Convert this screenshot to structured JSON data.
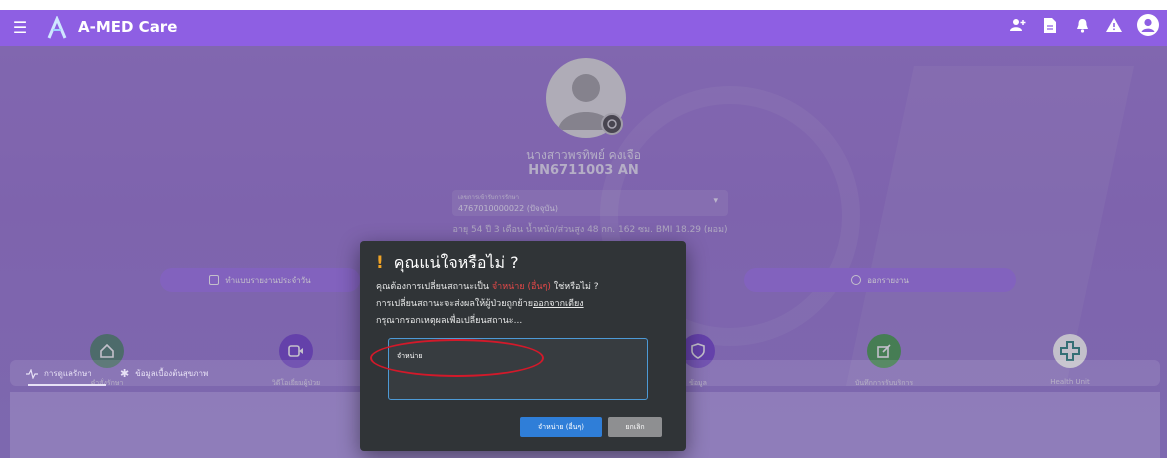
{
  "app": {
    "title": "A-MED Care"
  },
  "colors": {
    "appbar": "#8e5fe3",
    "accent_button": "#2f7ed8",
    "warning": "#f0a326",
    "highlight_red": "#e34848",
    "annotation_red": "#d3192a"
  },
  "header": {
    "icons": [
      "menu-icon",
      "app-logo",
      "add-user-icon",
      "document-icon",
      "bell-icon",
      "warning-icon",
      "account-icon"
    ]
  },
  "patient": {
    "name": "นางสาวพรทิพย์ คงเจือ",
    "hn": "HN6711003 AN",
    "visit_label": "เลขการเข้ารับการรักษา",
    "visit_value": "4767010000022 (ปัจจุบัน)",
    "info": "อายุ 54 ปี 3 เดือน น้ำหนัก/ส่วนสูง 48 กก. 162 ซม. BMI 18.29 (ผอม)"
  },
  "actions": {
    "daily_report": "ทำแบบรายงานประจำวัน",
    "logout": "ออกรายงาน"
  },
  "features": [
    {
      "label": "คำสั่งรักษา",
      "icon": "home-icon",
      "color": "#5c8a7a"
    },
    {
      "label": "วิดีโอเยี่ยมผู้ป่วย",
      "icon": "video-icon",
      "color": "#7c4fd1"
    },
    {
      "label": "ข้อมูล",
      "icon": "shield-icon",
      "color": "#7c4fd1"
    },
    {
      "label": "บันทึกการรับบริการ",
      "icon": "edit-icon",
      "color": "#52a35a"
    },
    {
      "label": "Health Unit",
      "icon": "medical-cross-icon",
      "color": "#ffffff"
    }
  ],
  "tabs": [
    {
      "label": "การดูแลรักษา"
    },
    {
      "label": "ข้อมูลเบื้องต้นสุขภาพ"
    }
  ],
  "dialog": {
    "bang": "!",
    "title": "คุณแน่ใจหรือไม่ ?",
    "line1_pre": "คุณต้องการเปลี่ยนสถานะเป็น",
    "line1_status": "จำหน่าย (อื่นๆ)",
    "line1_post": "ใช่หรือไม่ ?",
    "line2_pre": "การเปลี่ยนสถานะจะส่งผลให้ผู้ป่วยถูกย้าย",
    "line2_link": "ออกจากเตียง",
    "line3": "กรุณากรอกเหตุผลเพื่อเปลี่ยนสถานะ...",
    "reason_value": "จำหน่าย",
    "confirm_label": "จำหน่าย (อื่นๆ)",
    "cancel_label": "ยกเลิก"
  }
}
